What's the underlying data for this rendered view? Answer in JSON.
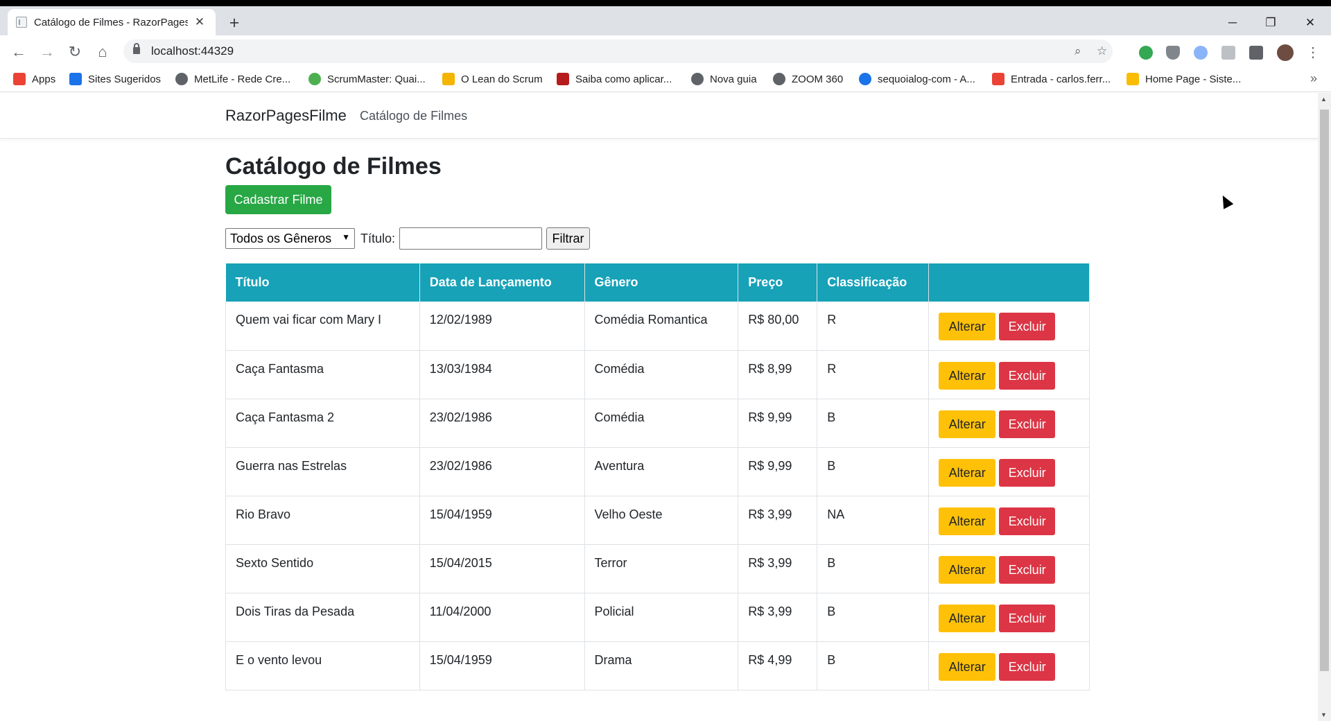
{
  "browser": {
    "tab_title": "Catálogo de Filmes - RazorPages",
    "tab_close": "✕",
    "new_tab": "+",
    "minimize": "─",
    "restore": "❐",
    "close": "✕",
    "back": "←",
    "forward": "→",
    "reload": "↻",
    "home": "⌂",
    "url": "localhost:44329",
    "zoom_icon": "⌕",
    "star_icon": "☆",
    "menu_icon": "⋮",
    "bookmarks_more": "»"
  },
  "bookmarks": [
    {
      "label": "Apps",
      "color": "#ea4335"
    },
    {
      "label": "Sites Sugeridos",
      "color": "#1a73e8"
    },
    {
      "label": "MetLife - Rede Cre...",
      "color": "#5f6368"
    },
    {
      "label": "ScrumMaster: Quai...",
      "color": "#4caf50"
    },
    {
      "label": "O Lean do Scrum",
      "color": "#f4b400"
    },
    {
      "label": "Saiba como aplicar...",
      "color": "#b71c1c"
    },
    {
      "label": "Nova guia",
      "color": "#5f6368"
    },
    {
      "label": "ZOOM 360",
      "color": "#5f6368"
    },
    {
      "label": "sequoialog-com - A...",
      "color": "#1a73e8"
    },
    {
      "label": "Entrada - carlos.ferr...",
      "color": "#ea4335"
    },
    {
      "label": "Home Page - Siste...",
      "color": "#fbbc04"
    }
  ],
  "app": {
    "brand": "RazorPagesFilme",
    "nav_link": "Catálogo de Filmes"
  },
  "page": {
    "title": "Catálogo de Filmes",
    "create_button": "Cadastrar Filme",
    "genre_select": "Todos os Gêneros",
    "title_label": "Título:",
    "title_input_value": "",
    "filter_button": "Filtrar"
  },
  "table": {
    "headers": [
      "Título",
      "Data de Lançamento",
      "Gênero",
      "Preço",
      "Classificação",
      ""
    ],
    "edit_label": "Alterar",
    "delete_label": "Excluir",
    "rows": [
      {
        "titulo": "Quem vai ficar com Mary I",
        "data": "12/02/1989",
        "genero": "Comédia Romantica",
        "preco": "R$ 80,00",
        "classificacao": "R"
      },
      {
        "titulo": "Caça Fantasma",
        "data": "13/03/1984",
        "genero": "Comédia",
        "preco": "R$ 8,99",
        "classificacao": "R"
      },
      {
        "titulo": "Caça Fantasma 2",
        "data": "23/02/1986",
        "genero": "Comédia",
        "preco": "R$ 9,99",
        "classificacao": "B"
      },
      {
        "titulo": "Guerra nas Estrelas",
        "data": "23/02/1986",
        "genero": "Aventura",
        "preco": "R$ 9,99",
        "classificacao": "B"
      },
      {
        "titulo": "Rio Bravo",
        "data": "15/04/1959",
        "genero": "Velho Oeste",
        "preco": "R$ 3,99",
        "classificacao": "NA"
      },
      {
        "titulo": "Sexto Sentido",
        "data": "15/04/2015",
        "genero": "Terror",
        "preco": "R$ 3,99",
        "classificacao": "B"
      },
      {
        "titulo": "Dois Tiras da Pesada",
        "data": "11/04/2000",
        "genero": "Policial",
        "preco": "R$ 3,99",
        "classificacao": "B"
      },
      {
        "titulo": "E o vento levou",
        "data": "15/04/1959",
        "genero": "Drama",
        "preco": "R$ 4,99",
        "classificacao": "B"
      }
    ]
  }
}
